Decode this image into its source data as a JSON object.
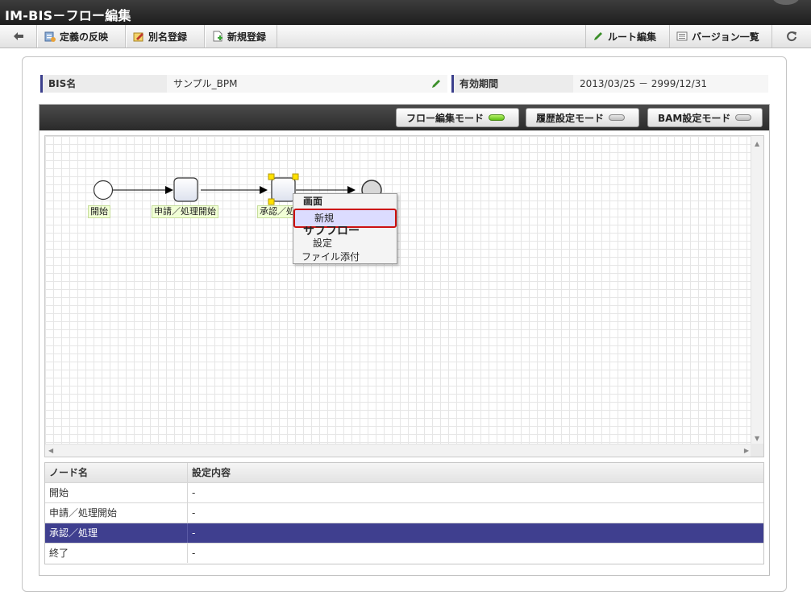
{
  "app": {
    "title": "IM-BIS－フロー編集"
  },
  "toolbar": {
    "back_icon": "arrow-left-icon",
    "apply_definition": "定義の反映",
    "alias_register": "別名登録",
    "new_register": "新規登録",
    "route_edit": "ルート編集",
    "version_list": "バージョン一覧",
    "refresh_icon": "refresh-icon"
  },
  "info": {
    "bis_name_label": "BIS名",
    "bis_name_value": "サンプル_BPM",
    "valid_period_label": "有効期間",
    "valid_period_value": "2013/03/25 － 2999/12/31"
  },
  "modes": {
    "flow_edit": "フロー編集モード",
    "flow_edit_active": true,
    "history_setting": "履歴設定モード",
    "history_setting_active": false,
    "bam_setting": "BAM設定モード",
    "bam_setting_active": false
  },
  "flow": {
    "nodes": [
      {
        "label": "開始",
        "type": "start"
      },
      {
        "label": "申請／処理開始",
        "type": "task"
      },
      {
        "label": "承認／処理",
        "type": "task",
        "selected": true
      },
      {
        "label": "終了",
        "type": "end"
      }
    ]
  },
  "context_menu": {
    "screen_header": "画面",
    "screen_new": "新規",
    "subflow_header": "サブフロー",
    "subflow_setting": "設定",
    "file_attach": "ファイル添付"
  },
  "table": {
    "headers": [
      "ノード名",
      "設定内容"
    ],
    "rows": [
      {
        "node": "開始",
        "setting": "-"
      },
      {
        "node": "申請／処理開始",
        "setting": "-"
      },
      {
        "node": "承認／処理",
        "setting": "-",
        "selected": true
      },
      {
        "node": "終了",
        "setting": "-"
      }
    ]
  },
  "colors": {
    "accent": "#3f3f8f",
    "highlight_border": "#cc1111",
    "mode_on": "#5dbf15"
  }
}
